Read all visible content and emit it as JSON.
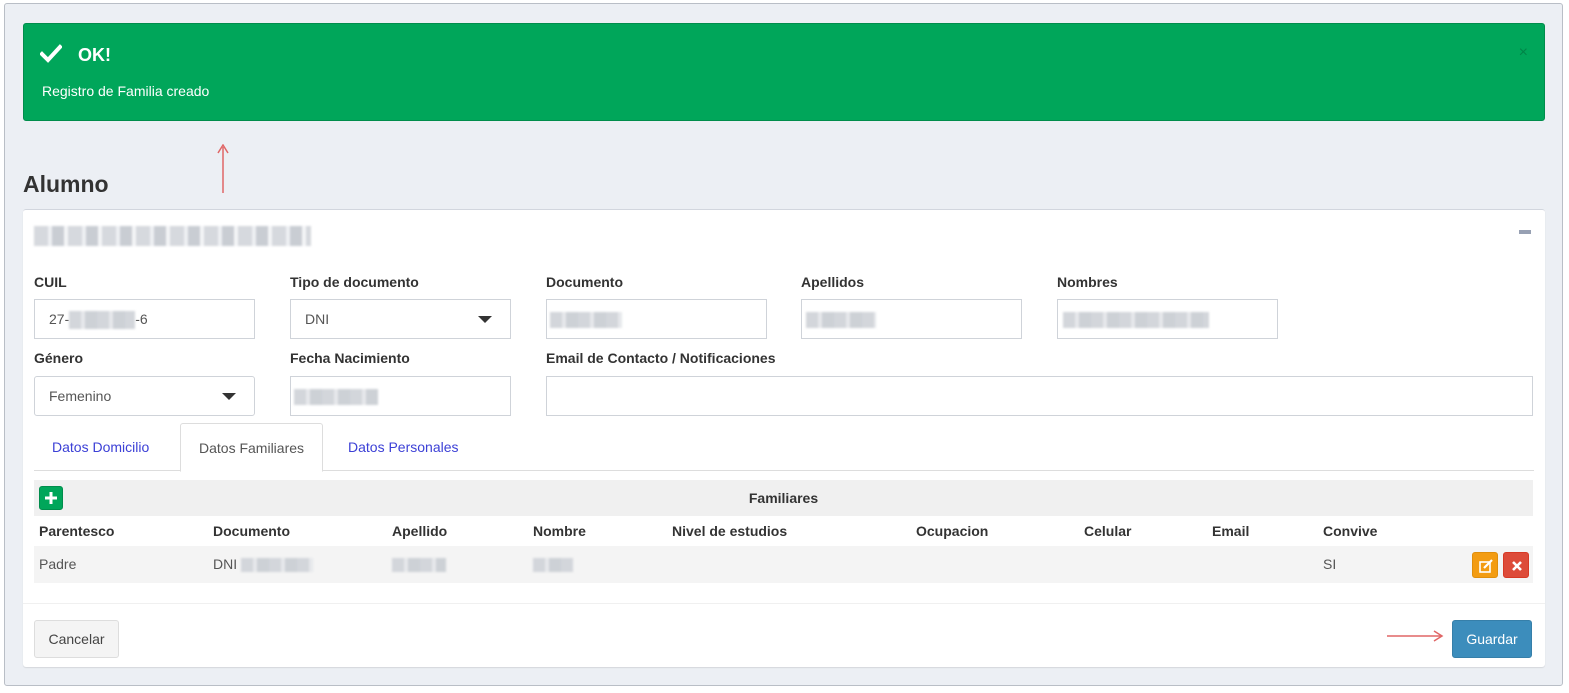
{
  "alert": {
    "title": "OK!",
    "message": "Registro de Familia creado",
    "close": "×",
    "color": "#00a65a"
  },
  "page": {
    "title": "Alumno"
  },
  "form": {
    "cuil": {
      "label": "CUIL",
      "prefix": "27-",
      "suffix": "-6"
    },
    "tipo_documento": {
      "label": "Tipo de documento",
      "value": "DNI"
    },
    "documento": {
      "label": "Documento"
    },
    "apellidos": {
      "label": "Apellidos"
    },
    "nombres": {
      "label": "Nombres"
    },
    "genero": {
      "label": "Género",
      "value": "Femenino"
    },
    "fecha_nacimiento": {
      "label": "Fecha Nacimiento"
    },
    "email": {
      "label": "Email de Contacto / Notificaciones",
      "value": ""
    }
  },
  "tabs": [
    {
      "label": "Datos Domicilio",
      "active": false
    },
    {
      "label": "Datos Familiares",
      "active": true
    },
    {
      "label": "Datos Personales",
      "active": false
    }
  ],
  "familiares": {
    "title": "Familiares",
    "add_icon": "plus-icon",
    "columns": [
      "Parentesco",
      "Documento",
      "Apellido",
      "Nombre",
      "Nivel de estudios",
      "Ocupacion",
      "Celular",
      "Email",
      "Convive"
    ],
    "rows": [
      {
        "parentesco": "Padre",
        "documento_tipo": "DNI",
        "nivel_estudios": "",
        "ocupacion": "",
        "celular": "",
        "email": "",
        "convive": "SI"
      }
    ]
  },
  "footer": {
    "cancel_label": "Cancelar",
    "save_label": "Guardar",
    "save_color": "#3c8dbc"
  }
}
